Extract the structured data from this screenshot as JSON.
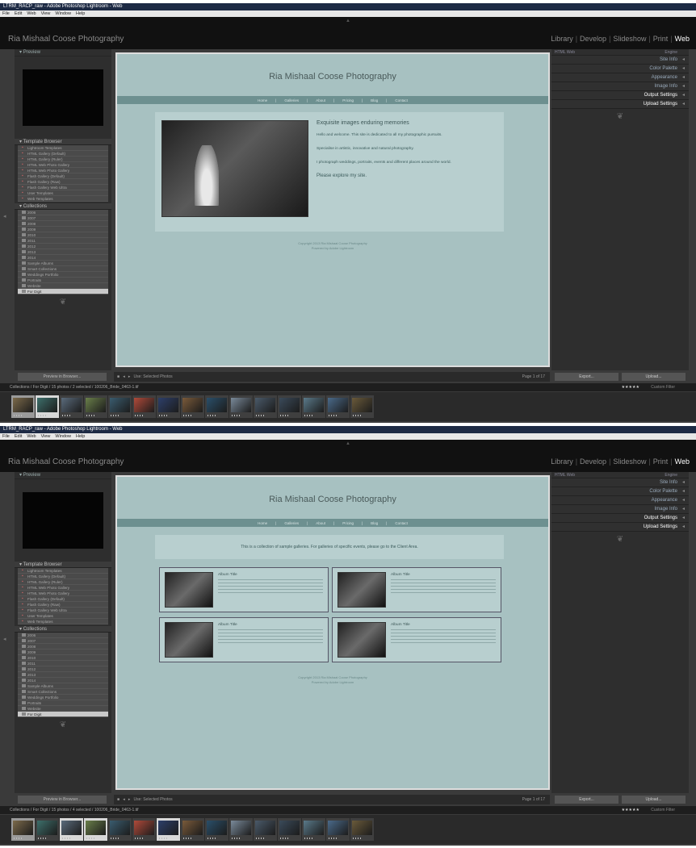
{
  "window_title": "LTRM_RACP_raw - Adobe Photoshop Lightroom - Web",
  "menu": [
    "File",
    "Edit",
    "Web",
    "View",
    "Window",
    "Help"
  ],
  "identity_plate": "Ria Mishaal Coose Photography",
  "modules": [
    "Library",
    "Develop",
    "Slideshow",
    "Print",
    "Web"
  ],
  "active_module": "Web",
  "left_panel": {
    "preview_label": "Preview",
    "template_browser_label": "Template Browser",
    "templates": [
      "Lightroom Templates",
      "HTML Gallery (Default)",
      "HTML Gallery (Ruler)",
      "HTML Web Photo Gallery",
      "HTML Web Photo Gallery",
      "Flash Gallery (Default)",
      "Flash Gallery (Raw)",
      "Flash Gallery Web Ultra",
      "User Templates",
      "Web Templates"
    ],
    "collections_label": "Collections",
    "collections": [
      "2006",
      "2007",
      "2008",
      "2009",
      "2010",
      "2011",
      "2012",
      "2013",
      "2014",
      "Sample Albums",
      "Smart Collections",
      "Weddings Portfolio",
      "Portraits",
      "Website",
      "Weddings"
    ],
    "selected_collection": "For Digit",
    "button": "Preview in Browser..."
  },
  "right_panel": {
    "engine_label": "Engine",
    "engine_value": "HTML Web",
    "sections": [
      "Engine",
      "Site Info",
      "Color Palette",
      "Appearance",
      "Image Info",
      "Output Settings",
      "Upload Settings"
    ],
    "buttons": [
      "Export...",
      "Upload..."
    ]
  },
  "site": {
    "title": "Ria Mishaal Coose Photography",
    "nav": [
      "Home",
      "Galleries",
      "About",
      "Pricing",
      "Blog",
      "Contact"
    ],
    "heading": "Exquisite images enduring memories",
    "paragraphs": [
      "Hello and welcome. This site is dedicated to all my photographic pursuits.",
      "Specialise in artistic, innovative and natural photography.",
      "I photograph weddings, portraits, events and different places around the world."
    ],
    "explore": "Please explore my site.",
    "footer_line1": "Copyright 2013 Ria Mishaal Coose Photography",
    "footer_line2": "Powered by Adobe Lightroom",
    "gallery_intro": "This is a collection of sample galleries. For galleries of specific events, please go to the Client Area.",
    "galleries": [
      {
        "title": "Album Title"
      },
      {
        "title": "Album Title"
      },
      {
        "title": "Album Title"
      },
      {
        "title": "Album Title"
      }
    ]
  },
  "toolbar": {
    "left": "Use: Selected Photos",
    "right": "Page 1 of 17"
  },
  "filmstrip": {
    "path_top": "Collections / For Digit / 15 photos / 2 selected / 100206_Bride_0463-1.tif",
    "path_bottom": "Collections / For Digit / 15 photos / 4 selected / 100206_Bride_0463-1.tif",
    "filter_label": "Filter:",
    "filter_value": "Custom Filter",
    "thumb_colors": [
      "#7c6a4a",
      "#3d6f6b",
      "#5a6b7c",
      "#6a7f4a",
      "#3a5c6f",
      "#b04a3a",
      "#2d3f6a",
      "#7a5a3a",
      "#2a4f6a",
      "#7a8a9a",
      "#4a5a6a",
      "#3a4a5a",
      "#5a7a8a",
      "#4a6a8a",
      "#6a5a3a"
    ]
  }
}
